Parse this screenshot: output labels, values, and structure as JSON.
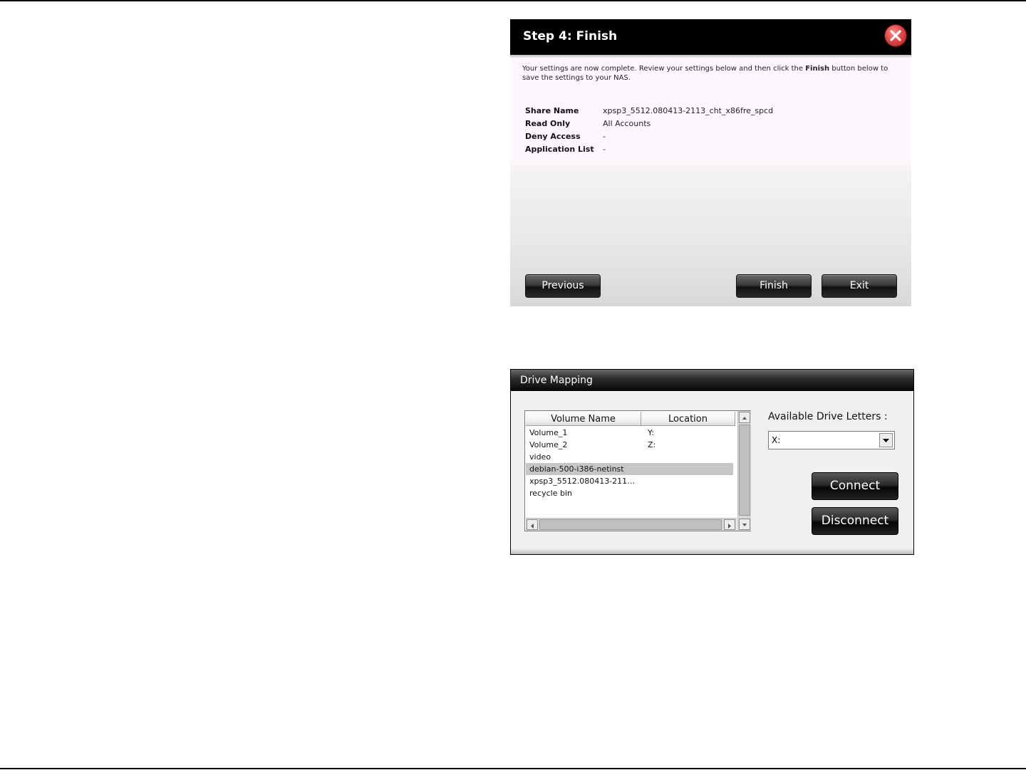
{
  "wizard": {
    "title": "Step 4: Finish",
    "intro_before": "Your settings are now complete. Review your settings below and then click the ",
    "intro_bold": "Finish",
    "intro_after": " button below to save the settings to your NAS.",
    "summary": [
      {
        "label": "Share Name",
        "value": "xpsp3_5512.080413-2113_cht_x86fre_spcd"
      },
      {
        "label": "Read Only",
        "value": "All Accounts"
      },
      {
        "label": "Deny Access",
        "value": "-"
      },
      {
        "label": "Application List",
        "value": "-"
      }
    ],
    "buttons": {
      "previous": "Previous",
      "finish": "Finish",
      "exit": "Exit"
    },
    "close_icon": "close-icon",
    "colors": {
      "header": "#000000",
      "close": "#e04848",
      "body": "#fdf8fd"
    }
  },
  "drive_mapping": {
    "title": "Drive Mapping",
    "columns": {
      "volume": "Volume Name",
      "location": "Location"
    },
    "rows": [
      {
        "name": "Volume_1",
        "location": "Y:",
        "selected": false
      },
      {
        "name": "Volume_2",
        "location": "Z:",
        "selected": false
      },
      {
        "name": "video",
        "location": "",
        "selected": false
      },
      {
        "name": "debian-500-i386-netinst",
        "location": "",
        "selected": true
      },
      {
        "name": "xpsp3_5512.080413-211…",
        "location": "",
        "selected": false
      },
      {
        "name": "recycle bin",
        "location": "",
        "selected": false
      }
    ],
    "available_label": "Available Drive Letters :",
    "selected_letter": "X:",
    "buttons": {
      "connect": "Connect",
      "disconnect": "Disconnect"
    }
  }
}
